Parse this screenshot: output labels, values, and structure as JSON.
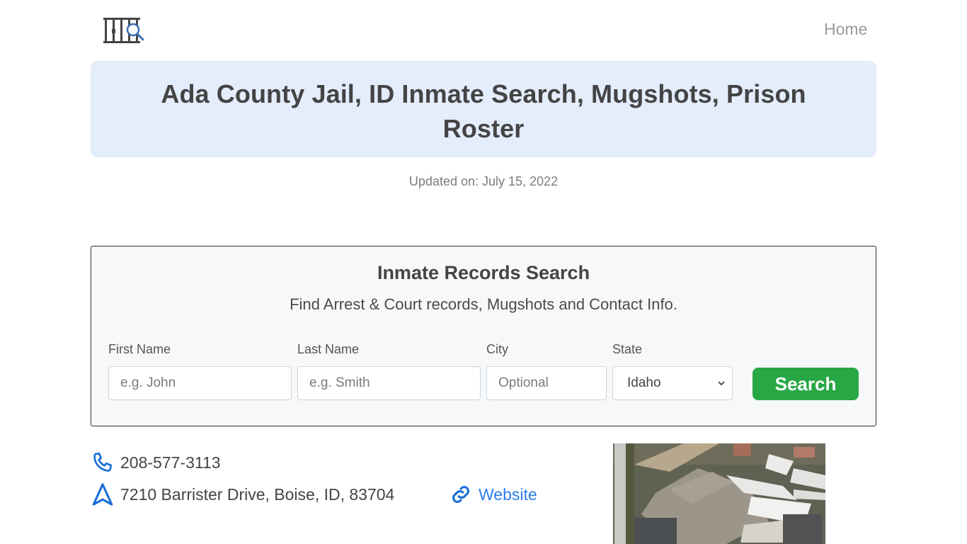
{
  "header": {
    "logo_icon": "jail-bars-search-icon",
    "nav": [
      {
        "label": "Home"
      }
    ]
  },
  "hero": {
    "title": "Ada County Jail, ID Inmate Search, Mugshots, Prison Roster",
    "background_color": "#e3edfb"
  },
  "updated": "Updated on: July 15, 2022",
  "search": {
    "title": "Inmate Records Search",
    "subtitle": "Find Arrest & Court records, Mugshots and Contact Info.",
    "fields": {
      "first_name": {
        "label": "First Name",
        "placeholder": "e.g. John",
        "value": ""
      },
      "last_name": {
        "label": "Last Name",
        "placeholder": "e.g. Smith",
        "value": ""
      },
      "city": {
        "label": "City",
        "placeholder": "Optional",
        "value": ""
      },
      "state": {
        "label": "State",
        "selected": "Idaho"
      }
    },
    "button_label": "Search",
    "button_color": "#28a745"
  },
  "contact": {
    "phone": "208-577-3113",
    "phone_icon": "phone-icon",
    "address": "7210 Barrister Drive, Boise, ID, 83704",
    "address_icon": "navigation-arrow-icon",
    "website_label": "Website",
    "website_icon": "link-icon",
    "accent_color": "#1a6fd8"
  },
  "facility_image": {
    "alt": "Aerial view of Ada County Jail facility"
  }
}
